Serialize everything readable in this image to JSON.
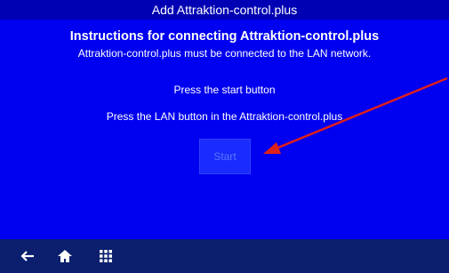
{
  "window": {
    "title": "Add Attraktion-control.plus"
  },
  "instructions": {
    "heading": "Instructions for connecting Attraktion-control.plus",
    "subheading": "Attraktion-control.plus must be connected to the LAN network.",
    "step1": "Press the start button",
    "step2": "Press the LAN button in the Attraktion-control.plus"
  },
  "start_button": {
    "label": "Start"
  },
  "annotation": {
    "arrow_color": "#e0201a"
  },
  "nav": {
    "icons": [
      "back-arrow-icon",
      "home-icon",
      "apps-grid-icon"
    ]
  },
  "colors": {
    "background": "#0000f0",
    "titlebar": "#0000b4",
    "bottombar": "#0b1f6e"
  }
}
